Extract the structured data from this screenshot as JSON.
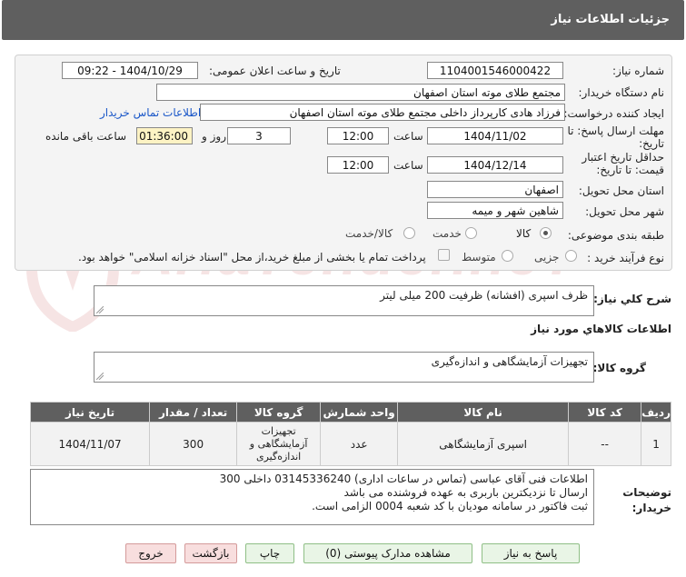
{
  "header": {
    "title": "جزئیات اطلاعات نیاز"
  },
  "form": {
    "need_number_label": "شماره نیاز:",
    "need_number": "1104001546000422",
    "announce_label": "تاریخ و ساعت اعلان عمومی:",
    "announce_value": "1404/10/29 - 09:22",
    "buyer_org_label": "نام دستگاه خریدار:",
    "buyer_org": "مجتمع طلای موته استان اصفهان",
    "creator_label": "ایجاد کننده درخواست:",
    "creator": "فرزاد هادی کارپرداز داخلی مجتمع طلای موته استان اصفهان",
    "contact_link": "اطلاعات تماس خریدار",
    "deadline_label": "مهلت ارسال پاسخ: تا تاریخ:",
    "deadline_date": "1404/11/02",
    "time_label": "ساعت",
    "deadline_time": "12:00",
    "days_value": "3",
    "days_label": "روز و",
    "remaining_time": "01:36:00",
    "remaining_label": "ساعت باقی مانده",
    "min_price_label": "حداقل تاریخ اعتبار قیمت: تا تاریخ:",
    "min_price_date": "1404/12/14",
    "min_price_time": "12:00",
    "province_label": "استان محل تحویل:",
    "province": "اصفهان",
    "city_label": "شهر محل تحویل:",
    "city": "شاهین شهر و میمه",
    "category_label": "طبقه بندی موضوعی:",
    "category_options": [
      "کالا",
      "خدمت",
      "کالا/خدمت"
    ],
    "process_label": "نوع فرآیند خرید :",
    "process_options": [
      "جزیی",
      "متوسط"
    ],
    "payment_note": "پرداخت تمام یا بخشی از مبلغ خرید،از محل \"اسناد خزانه اسلامی\" خواهد بود."
  },
  "summary": {
    "label": "شرح کلي نياز:",
    "value": "ظرف اسپری (افشانه) ظرفیت 200 میلی لیتر"
  },
  "goods_info_title": "اطلاعات كالاهاي مورد نياز",
  "goods_group": {
    "label": "گروه کالا:",
    "value": "تجهیزات آزمایشگاهی و اندازه‌گیری"
  },
  "table": {
    "headers": [
      "ردیف",
      "کد کالا",
      "نام کالا",
      "واحد شمارش",
      "گروه کالا",
      "تعداد / مقدار",
      "تاریخ نیاز"
    ],
    "rows": [
      [
        "1",
        "--",
        "اسپری آزمایشگاهی",
        "عدد",
        "تجهیزات آزمایشگاهی و اندازه‌گیری",
        "300",
        "1404/11/07"
      ]
    ]
  },
  "buyer_notes": {
    "label": "توضیحات خریدار:",
    "lines": [
      "اطلاعات فنی آقای عباسی (تماس در ساعات اداری) 03145336240 داخلی 300",
      "ارسال تا نزدیکترین باربری به عهده فروشنده می باشد",
      "ثبت فاکتور در سامانه مودیان با کد شعبه 0004 الزامی است."
    ]
  },
  "buttons": {
    "reply": "پاسخ به نیاز",
    "attachments": "مشاهده مدارک پیوستی (0)",
    "print": "چاپ",
    "back": "بازگشت",
    "exit": "خروج"
  },
  "watermark": {
    "text": "AriaTender.neT"
  },
  "colors": {
    "header_bg": "#5f5f5f",
    "link": "#1a57c8",
    "time_highlight": "#fdf3c4",
    "button_green": "#e9f5e6",
    "button_red": "#f8dede"
  }
}
